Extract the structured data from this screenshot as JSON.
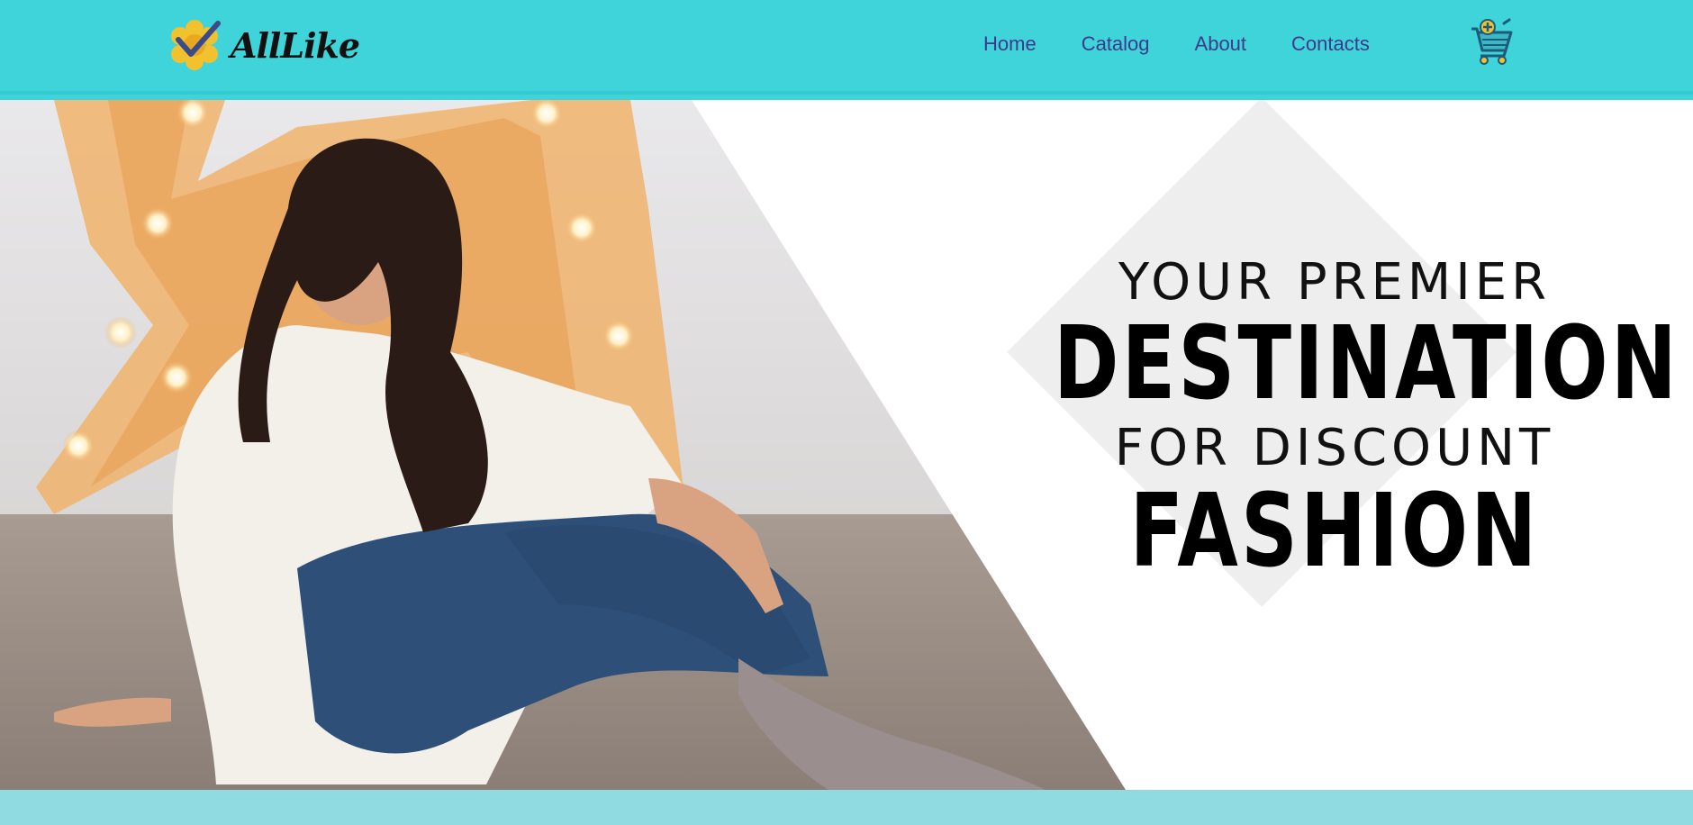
{
  "brand": {
    "name": "AllLike",
    "logo_icon": "sunflower-check-icon",
    "colors": {
      "header": "#3fd4da",
      "nav_text": "#3d3a8c",
      "accent_yellow": "#f2c12e",
      "footer_band": "#8fdbe1"
    }
  },
  "nav": {
    "items": [
      {
        "label": "Home"
      },
      {
        "label": "Catalog"
      },
      {
        "label": "About"
      },
      {
        "label": "Contacts"
      }
    ]
  },
  "cart": {
    "icon": "shopping-cart-add-icon"
  },
  "hero": {
    "image": "woman-sitting-jeans-photo",
    "line1": "YOUR PREMIER",
    "line2": "DESTINATION",
    "line3": "FOR DISCOUNT",
    "line4": "FASHION"
  }
}
